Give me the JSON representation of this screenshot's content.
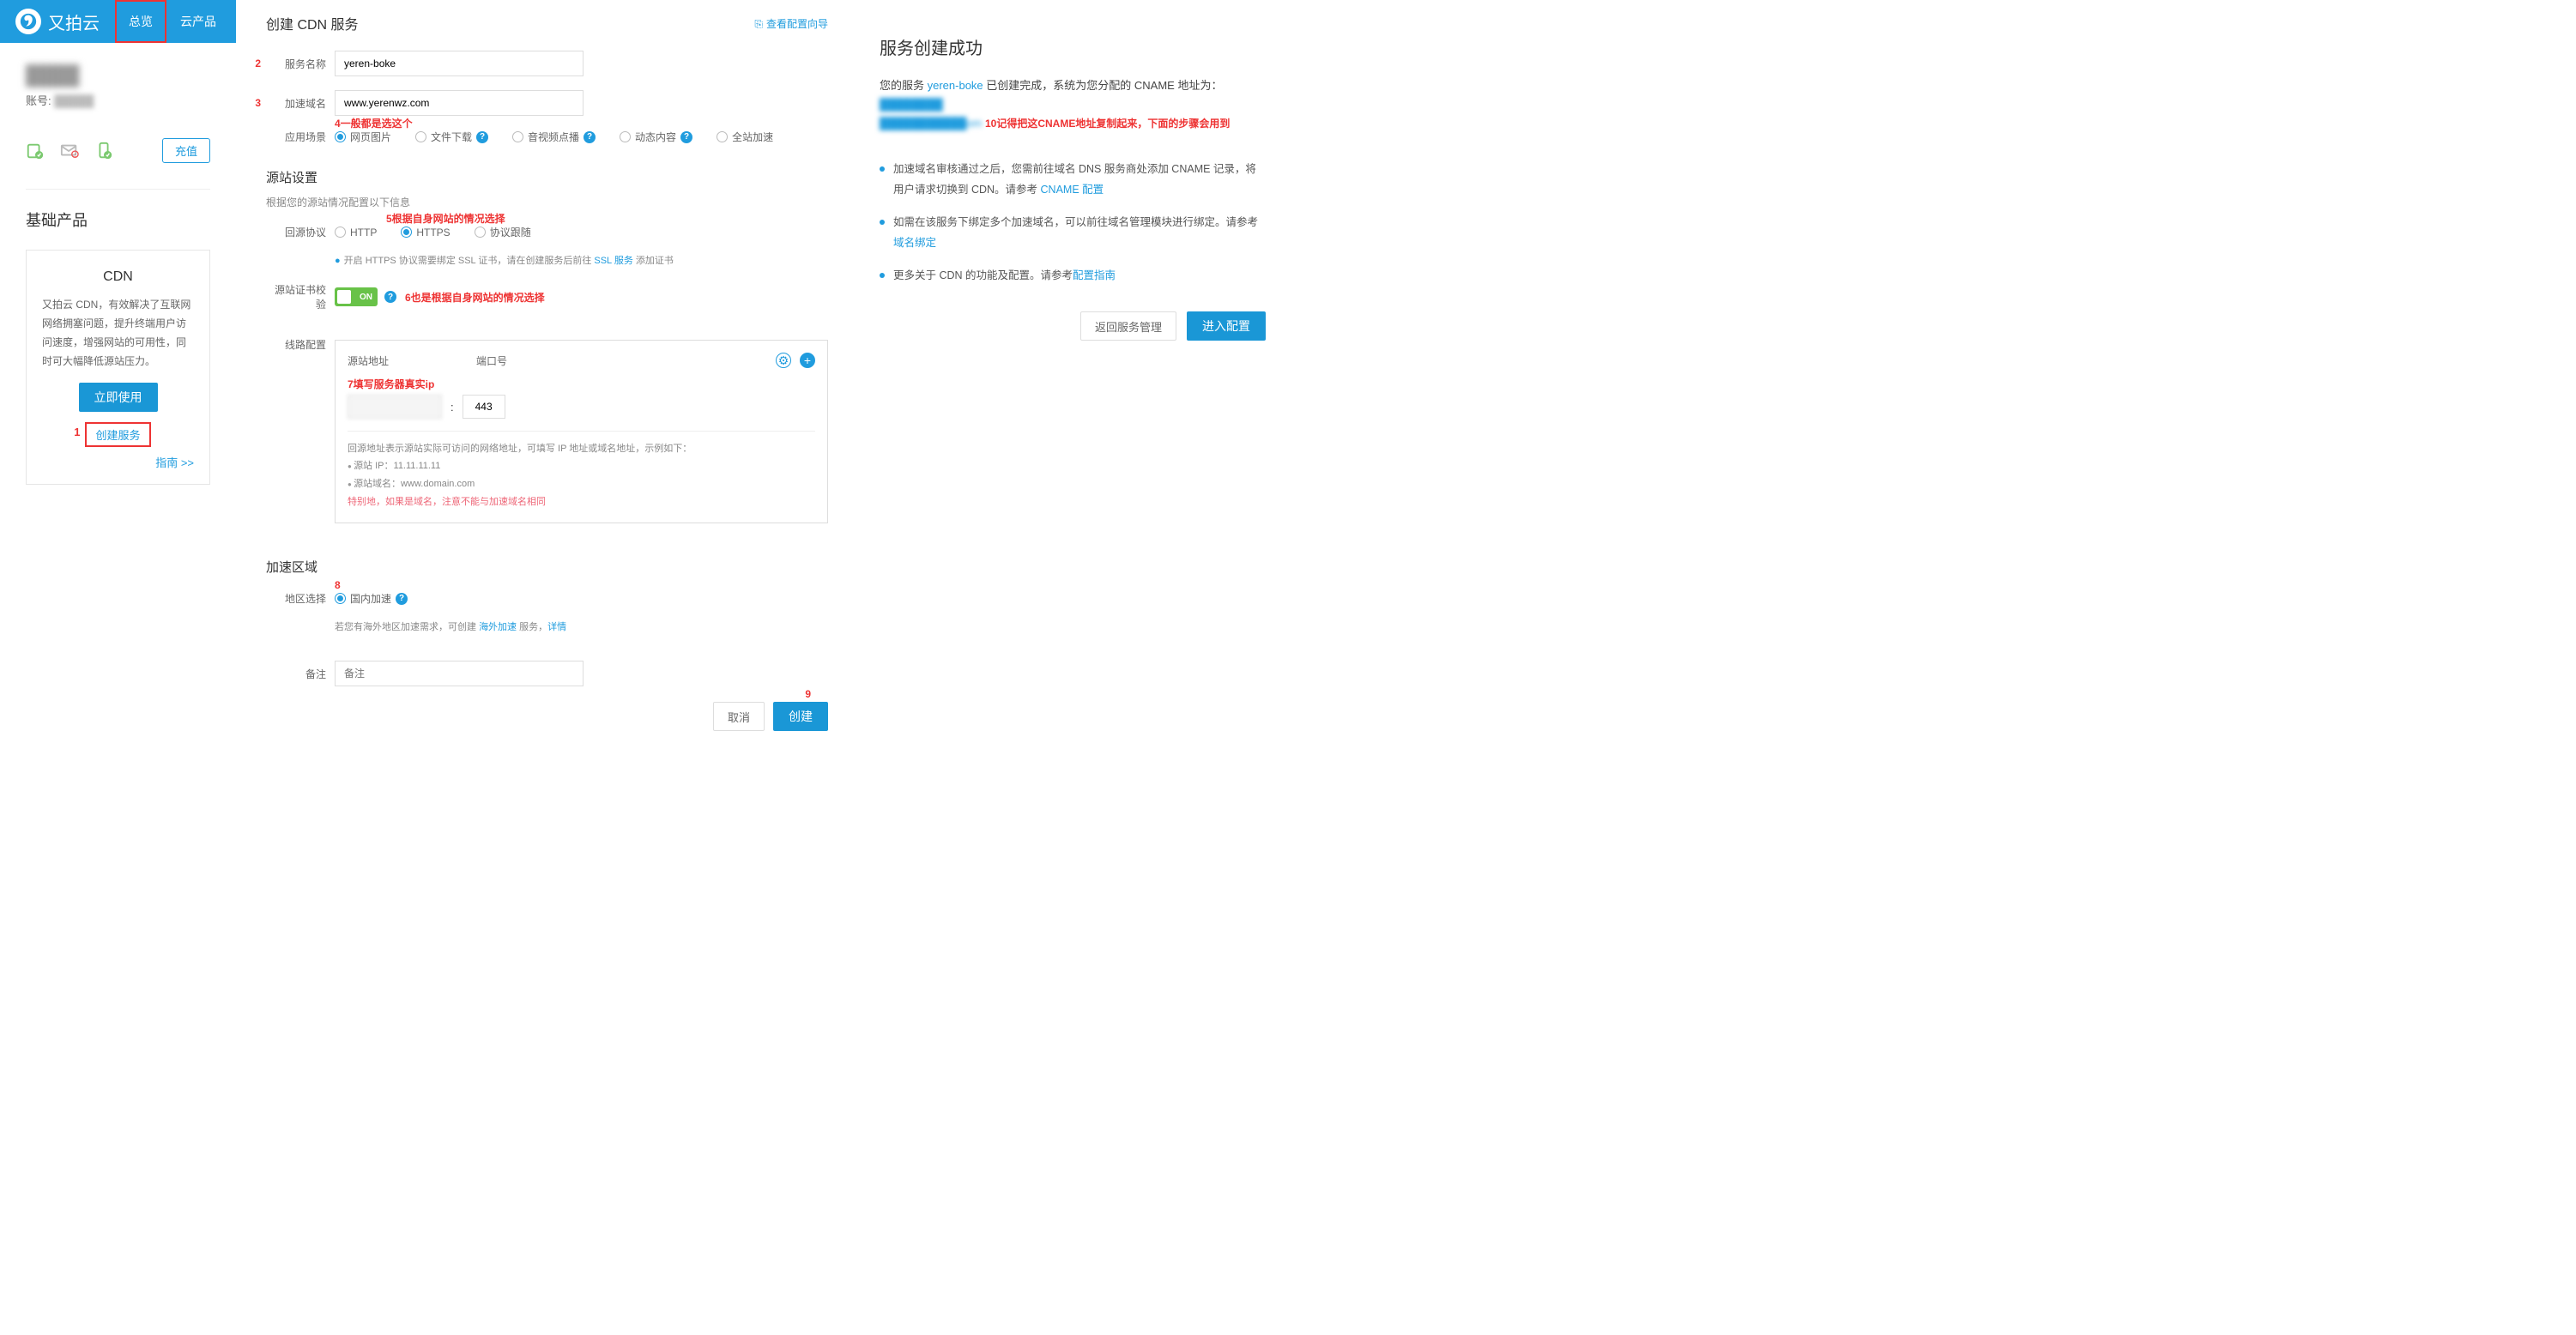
{
  "nav": {
    "brand": "又拍云",
    "tab_overview": "总览",
    "tab_products": "云产品"
  },
  "sidebar": {
    "account_label": "账号:",
    "recharge": "充值",
    "section_title": "基础产品",
    "cdn_title": "CDN",
    "cdn_desc": "又拍云 CDN，有效解决了互联网网络拥塞问题，提升终端用户访问速度，增强网站的可用性，同时可大幅降低源站压力。",
    "use_now": "立即使用",
    "create_service": "创建服务",
    "guide": "指南 >>",
    "step1": "1"
  },
  "form": {
    "title": "创建 CDN 服务",
    "wizard": "查看配置向导",
    "service_name_label": "服务名称",
    "service_name_value": "yeren-boke",
    "step2": "2",
    "domain_label": "加速域名",
    "domain_value": "www.yerenwz.com",
    "step3": "3",
    "scene_label": "应用场景",
    "scene_opts": [
      "网页图片",
      "文件下载",
      "音视频点播",
      "动态内容",
      "全站加速"
    ],
    "annot4": "4一般都是选这个",
    "origin_section": "源站设置",
    "origin_sub": "根据您的源站情况配置以下信息",
    "annot5": "5根据自身网站的情况选择",
    "proto_label": "回源协议",
    "proto_opts": [
      "HTTP",
      "HTTPS",
      "协议跟随"
    ],
    "https_hint_a": "开启 HTTPS 协议需要绑定 SSL 证书，请在创建服务后前往 ",
    "https_hint_link": "SSL 服务",
    "https_hint_b": " 添加证书",
    "cert_label": "源站证书校验",
    "switch_on": "ON",
    "annot6": "6也是根据自身网站的情况选择",
    "line_label": "线路配置",
    "origin_addr": "源站地址",
    "port_label": "端口号",
    "annot7": "7填写服务器真实ip",
    "port_value": "443",
    "lc_desc": "回源地址表示源站实际可访问的网络地址，可填写 IP 地址或域名地址，示例如下：",
    "lc_ip": "源站 IP：11.11.11.11",
    "lc_domain": "源站域名：www.domain.com",
    "lc_warn": "特别地，如果是域名，注意不能与加速域名相同",
    "region_section": "加速区域",
    "region_label": "地区选择",
    "region_opt": "国内加速",
    "step8": "8",
    "region_hint_a": "若您有海外地区加速需求，可创建 ",
    "region_hint_link": "海外加速",
    "region_hint_b": " 服务，",
    "region_hint_detail": "详情",
    "remark_label": "备注",
    "remark_placeholder": "备注",
    "cancel": "取消",
    "create": "创建",
    "step9": "9"
  },
  "right": {
    "title": "服务创建成功",
    "msg_a": "您的服务 ",
    "svc": "yeren-boke",
    "msg_b": " 已创建完成，系统为您分配的 CNAME 地址为：",
    "annot10": "10记得把这CNAME地址复制起来，下面的步骤会用到",
    "items": [
      {
        "text": "加速域名审核通过之后，您需前往域名 DNS 服务商处添加 CNAME 记录，将用户请求切换到 CDN。请参考 ",
        "link": "CNAME 配置"
      },
      {
        "text": "如需在该服务下绑定多个加速域名，可以前往域名管理模块进行绑定。请参考",
        "link": "域名绑定"
      },
      {
        "text": "更多关于 CDN 的功能及配置。请参考",
        "link": "配置指南"
      }
    ],
    "back": "返回服务管理",
    "goto": "进入配置"
  }
}
